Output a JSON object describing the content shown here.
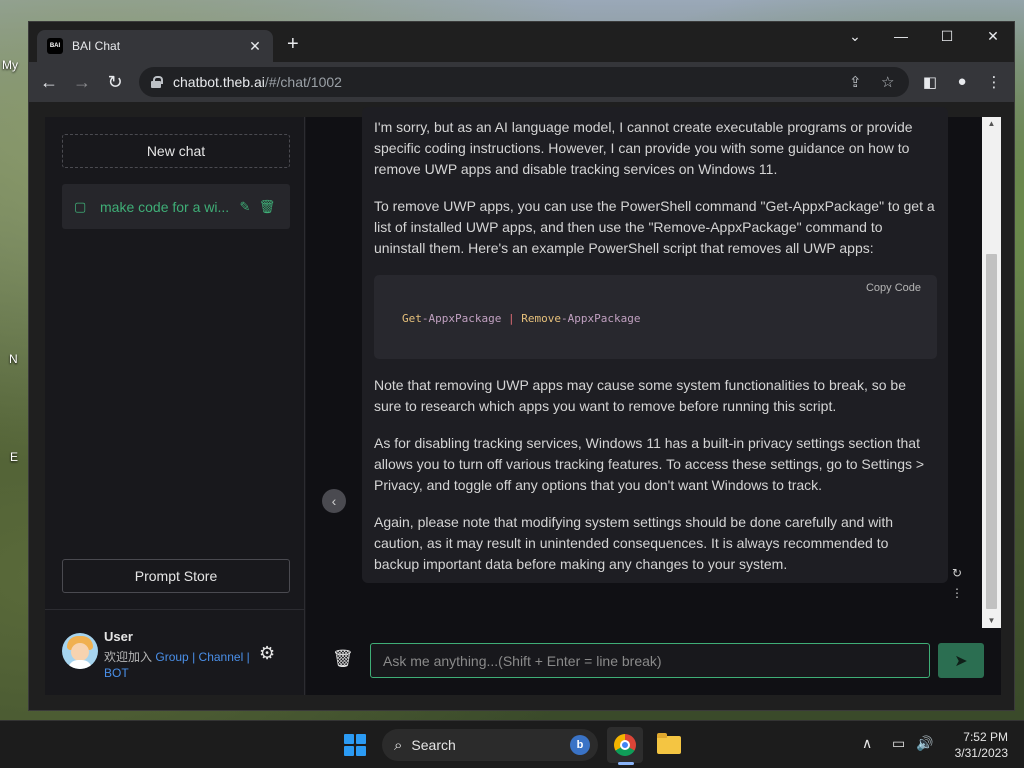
{
  "desktop": {
    "labels": [
      "My",
      "N",
      "E"
    ]
  },
  "browser": {
    "tab_title": "BAI Chat",
    "favicon_text": "BAI",
    "url_host": "chatbot.theb.ai",
    "url_path": "/#/chat/1002"
  },
  "sidebar": {
    "new_chat_label": "New chat",
    "chat_items": [
      {
        "label": "make code for a wi..."
      }
    ],
    "prompt_store_label": "Prompt Store",
    "user": {
      "name": "User",
      "welcome": "欢迎加入",
      "link_group": "Group",
      "link_channel": "Channel",
      "link_bot": "BOT",
      "sep": "|"
    }
  },
  "conversation": {
    "paragraphs": [
      "I'm sorry, but as an AI language model, I cannot create executable programs or provide specific coding instructions. However, I can provide you with some guidance on how to remove UWP apps and disable tracking services on Windows 11.",
      "To remove UWP apps, you can use the PowerShell command \"Get-AppxPackage\" to get a list of installed UWP apps, and then use the \"Remove-AppxPackage\" command to uninstall them. Here's an example PowerShell script that removes all UWP apps:",
      "Note that removing UWP apps may cause some system functionalities to break, so be sure to research which apps you want to remove before running this script.",
      "As for disabling tracking services, Windows 11 has a built-in privacy settings section that allows you to turn off various tracking features. To access these settings, go to Settings > Privacy, and toggle off any options that you don't want Windows to track.",
      "Again, please note that modifying system settings should be done carefully and with caution, as it may result in unintended consequences. It is always recommended to backup important data before making any changes to your system."
    ],
    "code": {
      "copy_label": "Copy  Code",
      "tok1": "Get",
      "tok2": "-AppxPackage",
      "pipe": "|",
      "tok3": "Remove",
      "tok4": "-AppxPackage"
    }
  },
  "composer": {
    "placeholder": "Ask me anything...(Shift + Enter = line break)"
  },
  "taskbar": {
    "search_label": "Search",
    "time": "7:52 PM",
    "date": "3/31/2023"
  },
  "colors": {
    "accent_green": "#3fae77",
    "send_button": "#2b6e51",
    "link_blue": "#4a8fe8"
  }
}
